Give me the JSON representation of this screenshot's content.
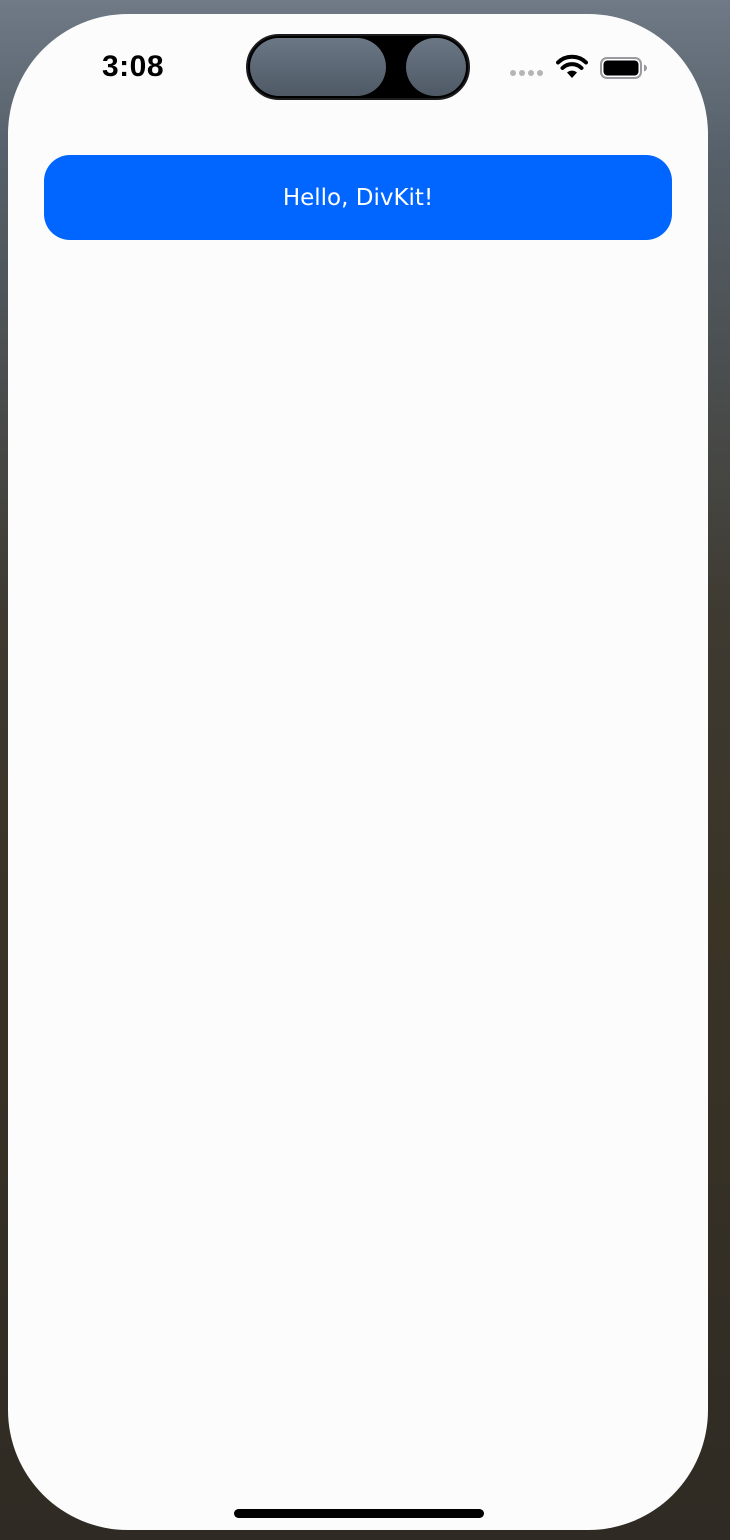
{
  "status_bar": {
    "time": "3:08",
    "icons": [
      "cellular-signal-icon",
      "wifi-icon",
      "battery-icon"
    ]
  },
  "main": {
    "card_text": "Hello, DivKit!",
    "card_color": "#0066FF",
    "text_color": "#FFFFFF"
  },
  "colors": {
    "screen_background": "#FCFCFC"
  }
}
